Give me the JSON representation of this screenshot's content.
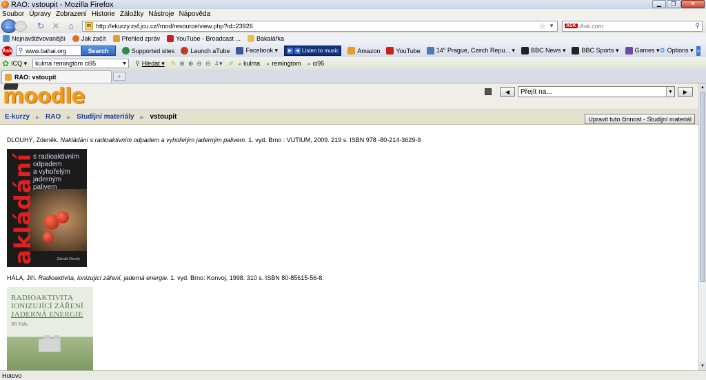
{
  "window": {
    "title": "RAO: vstoupit - Mozilla Firefox"
  },
  "menu": [
    "Soubor",
    "Úpravy",
    "Zobrazení",
    "Historie",
    "Záložky",
    "Nástroje",
    "Nápověda"
  ],
  "nav": {
    "url": "http://ekurzy.zsf.jcu.cz//mod/resource/view.php?id=23926",
    "search_placeholder": "Ask.com",
    "search_badge": "ASK"
  },
  "bookmarks": [
    {
      "label": "Nejnavštěvovanější",
      "color": "#4a8fd8"
    },
    {
      "label": "Jak začít",
      "color": "#e06d1a"
    },
    {
      "label": "Přehled zpráv",
      "color": "#e89b2a"
    },
    {
      "label": "YouTube - Broadcast ...",
      "color": "#cc1f1f"
    },
    {
      "label": "Bakalářka",
      "color": "#e8c34a"
    }
  ],
  "ask_toolbar": {
    "logo": "Ask",
    "search_value": "www.bahai.org",
    "search_button": "Search",
    "items_a": [
      {
        "label": "Supported sites",
        "color": "#2f8a4a"
      },
      {
        "label": "Launch aTube",
        "color": "#c23b1d"
      },
      {
        "label": "Facebook ▾",
        "color": "#3b5998"
      }
    ],
    "listen": "Listen to music",
    "items_b": [
      {
        "label": "Amazon",
        "color": "#e89b2a"
      },
      {
        "label": "YouTube",
        "color": "#cc1f1f"
      },
      {
        "label": "14° Prague, Czech Repu... ▾",
        "color": "#4a78b8"
      },
      {
        "label": "BBC News ▾",
        "color": "#222"
      },
      {
        "label": "BBC Sports ▾",
        "color": "#222"
      },
      {
        "label": "Games ▾",
        "color": "#6b4aa8"
      }
    ],
    "options": "Options ▾",
    "more": "»"
  },
  "icq_toolbar": {
    "label": "ICQ ▾",
    "search_value": "kulma remingtom ci95",
    "find": "Hledat ▾",
    "words": [
      "kulma",
      "remingtom",
      "ci95"
    ]
  },
  "tab": {
    "label": "RAO: vstoupit",
    "new": "+"
  },
  "page": {
    "logo": "moodle",
    "jump_to": "Přejít na...",
    "jump_prev": "◀",
    "jump_next": "▶",
    "breadcrumb": [
      {
        "label": "E-kurzy",
        "link": true
      },
      {
        "label": "RAO",
        "link": true
      },
      {
        "label": "Studijní materiály",
        "link": true
      },
      {
        "label": "vstoupit",
        "link": false
      }
    ],
    "edit_button": "Upravit tuto činnost - Studijní materiál",
    "refs": [
      {
        "author": "DLOUHÝ, Zdeněk.",
        "title": "Nakládání s radioaktivním odpadem a vyhořelým jaderným palivem.",
        "rest": "1. vyd. Brno : VUTIUM, 2009. 219 s. ISBN 978 -80-214-3629-9"
      },
      {
        "author": "HÁLA, Jiří.",
        "title": "Radioaktivita, ionizující záření, jaderná energie.",
        "rest": "1. vyd. Brno: Konvoj, 1998. 310 s. ISBN 80-85615-56-8."
      }
    ],
    "book1": {
      "vertical": "nakládání",
      "subtitle": [
        "s radioaktivním",
        "odpadem",
        "a vyhořelým",
        "jaderným",
        "palivem"
      ],
      "author": "Zdeněk Dlouhý"
    },
    "book2": {
      "title": [
        "RADIOAKTIVITA",
        "IONIZUJÍCÍ ZÁŘENÍ",
        "JADERNÁ ENERGIE"
      ],
      "author": "Jiří Hála"
    }
  },
  "status": "Hotovo"
}
